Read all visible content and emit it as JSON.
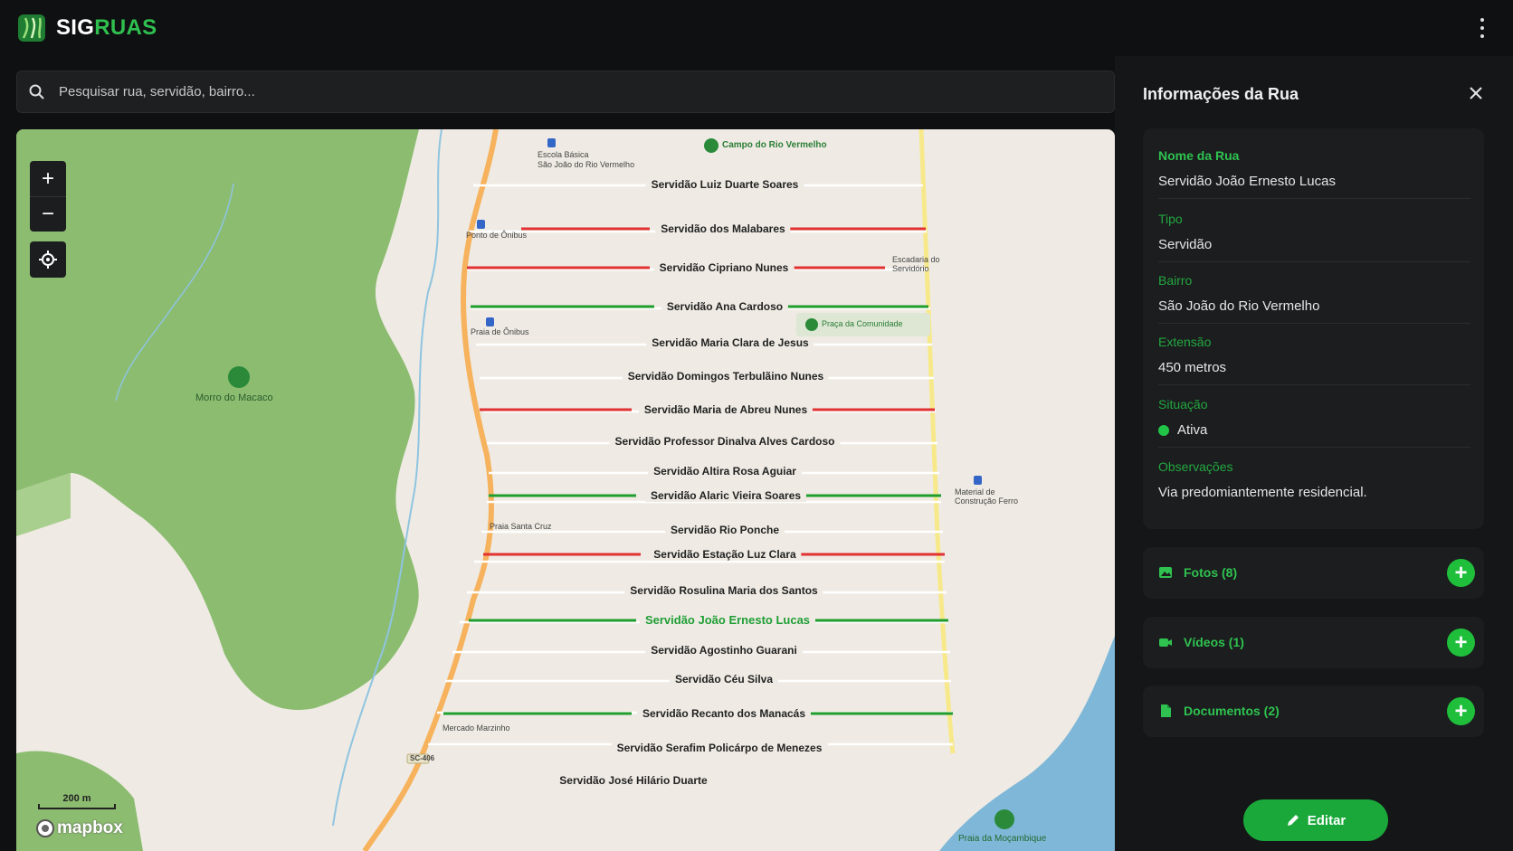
{
  "app": {
    "brand_a": "SIG",
    "brand_b": "RUAS"
  },
  "search": {
    "placeholder": "Pesquisar rua, servidão, bairro..."
  },
  "map": {
    "streets": [
      {
        "label": "Servidão Luiz Duarte Soares",
        "status": "none"
      },
      {
        "label": "Servidão dos Malabares",
        "status": "red"
      },
      {
        "label": "Servidão Cipriano Nunes",
        "status": "red"
      },
      {
        "label": "Servidão Ana Cardoso",
        "status": "green"
      },
      {
        "label": "Servidão Maria Clara de Jesus",
        "status": "none"
      },
      {
        "label": "Servidão Domingos Terbulãino Nunes",
        "status": "none"
      },
      {
        "label": "Servidão Maria de Abreu Nunes",
        "status": "red"
      },
      {
        "label": "Servidão Professor Dinalva Alves Cardoso",
        "status": "none"
      },
      {
        "label": "Servidão Altira Rosa Aguiar",
        "status": "none"
      },
      {
        "label": "Servidão Alaric Vieira Soares",
        "status": "green"
      },
      {
        "label": "Servidão Rio Ponche",
        "status": "none"
      },
      {
        "label": "Servidão Estação Luz Clara",
        "status": "red"
      },
      {
        "label": "Servidão Rosulina Maria dos Santos",
        "status": "none"
      },
      {
        "label": "Servidão João Ernesto Lucas",
        "status": "selected"
      },
      {
        "label": "Servidão Agostinho Guarani",
        "status": "none"
      },
      {
        "label": "Servidão Céu Silva",
        "status": "none"
      },
      {
        "label": "Servidão Recanto dos Manacás",
        "status": "green"
      },
      {
        "label": "Servidão Serafim Policárpo de Menezes",
        "status": "none"
      },
      {
        "label": "Servidão José Hilário Duarte",
        "status": "none"
      }
    ],
    "pois": {
      "school": "Escola Básica",
      "school2": "São João do Rio Vermelho",
      "field": "Campo do Rio Vermelho",
      "bus": "Ponto de Ônibus",
      "stairs": "Escadaria do",
      "stairs2": "Servidório",
      "beach1": "Praia de Ônibus",
      "square": "Praça da Comunidade",
      "hill": "Morro do Macaco",
      "material": "Material de",
      "material2": "Construção Ferro",
      "santacruz": "Praia Santa Cruz",
      "market": "Mercado Marzinho",
      "road": "SC-406",
      "beach2": "Praia da Moçambique"
    },
    "scale": "200 m",
    "attribution": "mapbox",
    "colors": {
      "red": "#e03232",
      "green": "#1f9e2d",
      "selected": "#1f9e35"
    }
  },
  "panel": {
    "title": "Informações da Rua",
    "fields": {
      "name_k": "Nome da Rua",
      "name_v": "Servidão João Ernesto Lucas",
      "type_k": "Tipo",
      "type_v": "Servidão",
      "bairro_k": "Bairro",
      "bairro_v": "São João do Rio Vermelho",
      "ext_k": "Extensão",
      "ext_v": "450 metros",
      "sit_k": "Situação",
      "sit_v": "Ativa",
      "obs_k": "Observações",
      "obs_v": "Via predomiantemente residencial."
    },
    "sections": [
      {
        "label": "Fotos (8)",
        "icon": "image-icon"
      },
      {
        "label": "Vídeos (1)",
        "icon": "video-icon"
      },
      {
        "label": "Documentos (2)",
        "icon": "document-icon"
      }
    ],
    "edit_label": "Editar"
  }
}
